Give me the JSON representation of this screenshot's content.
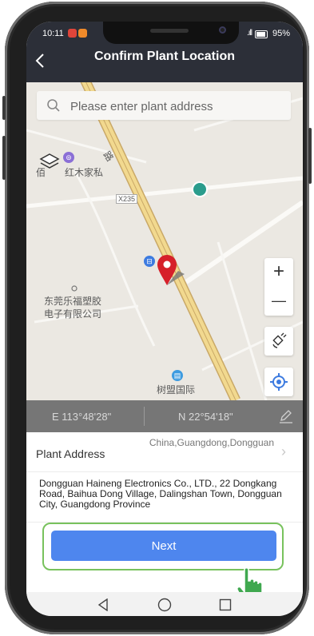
{
  "status_bar": {
    "time": "10:11",
    "battery": "95%"
  },
  "header": {
    "title": "Confirm Plant Location",
    "back_icon": "chevron-left-icon"
  },
  "map": {
    "search_placeholder": "Please enter plant address",
    "labels": {
      "poi_top": "佰",
      "poi_top_name": "红木家私",
      "road_code": "X235",
      "road_name": "路",
      "company_line1": "东莞乐福塑胶",
      "company_line2": "电子有限公司",
      "landmark": "树盟国际"
    },
    "controls": {
      "zoom_in": "+",
      "zoom_out": "—"
    },
    "pin_color": "#d6202a"
  },
  "coordinates": {
    "longitude": "E 113°48'28\"",
    "latitude": "N 22°54'18\""
  },
  "address": {
    "label": "Plant Address",
    "value": "China,Guangdong,Dongguan",
    "full": "Dongguan Haineng Electronics Co., LTD., 22 Dongkang Road, Baihua Dong Village, Dalingshan Town, Dongguan City, Guangdong Province"
  },
  "next_button": {
    "label": "Next",
    "color": "#4e86ee",
    "highlight_color": "#78c25d"
  }
}
